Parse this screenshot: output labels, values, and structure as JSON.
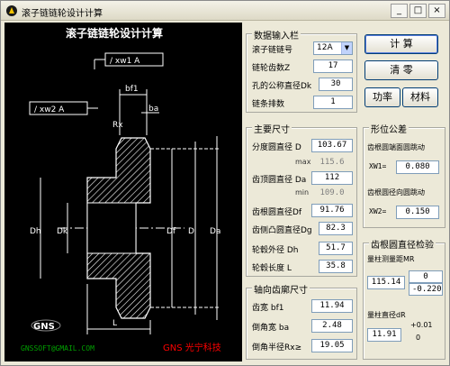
{
  "window": {
    "title": "滚子链链轮设计计算",
    "controls": [
      "_",
      "□",
      "×"
    ]
  },
  "drawing": {
    "heading": "滚子链链轮设计计算",
    "tol1": "/  xw1  A",
    "tol2": "/  xw2  A",
    "dims": {
      "bf1": "bf1",
      "ba": "ba",
      "rx": "Rx",
      "dh": "Dh",
      "dk": "Dk",
      "df": "Df",
      "d": "D",
      "da": "Da",
      "l": "L"
    },
    "logo": "GNS",
    "email": "GNSSOFT@GMAIL.COM",
    "brand": "GNS 光宁科技"
  },
  "input": {
    "legend": "数据输入栏",
    "chain_no_label": "滚子链链号",
    "chain_no": "12A",
    "teeth_label": "链轮齿数Z",
    "teeth": "17",
    "bore_label": "孔的公称直径Dk",
    "bore": "30",
    "rows_label": "链条排数",
    "rows": "1"
  },
  "buttons": {
    "calc": "计 算",
    "clear": "清 零",
    "power": "功率",
    "material": "材料"
  },
  "main_dims": {
    "legend": "主要尺寸",
    "pitch_label": "分度圆直径 D",
    "pitch": "103.67",
    "max_label": "max",
    "max": "115.6",
    "tip_label": "齿顶圆直径 Da",
    "tip": "112",
    "min_label": "min",
    "min": "109.0",
    "root_label": "齿根圆直径Df",
    "root": "91.76",
    "flange_label": "齿侧凸圆直径Dg",
    "flange": "82.3",
    "hub_od_label": "轮毂外径 Dh",
    "hub_od": "51.7",
    "hub_len_label": "轮毂长度 L",
    "hub_len": "35.8"
  },
  "axial": {
    "legend": "轴向齿廓尺寸",
    "width_label": "齿宽 bf1",
    "width": "11.94",
    "chamfer_w_label": "倒角宽 ba",
    "chamfer_w": "2.48",
    "chamfer_r_label": "倒角半径Rx≥",
    "chamfer_r": "19.05"
  },
  "tolerance": {
    "legend": "形位公差",
    "face_label": "齿根圆端面圆跳动",
    "xw1_label": "XW1=",
    "xw1": "0.080",
    "radial_label": "齿根圆径向圆跳动",
    "xw2_label": "XW2=",
    "xw2": "0.150"
  },
  "inspect": {
    "legend": "齿根圆直径检验",
    "mr_label": "量柱测量距MR",
    "mr": "115.14",
    "mr_up": "0",
    "mr_low": "-0.220",
    "dr_label": "量柱直径dR",
    "dr": "11.91",
    "dr_up": "+0.01",
    "dr_low": "0"
  }
}
